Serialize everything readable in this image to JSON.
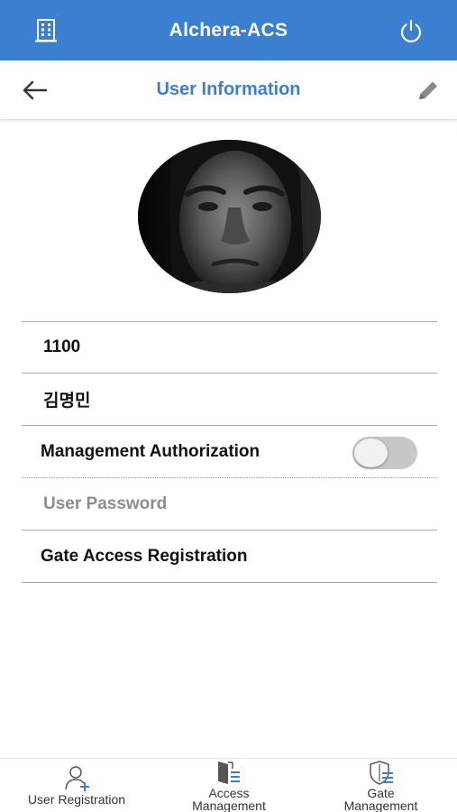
{
  "app_bar": {
    "title": "Alchera-ACS",
    "left_icon": "building-icon",
    "right_icon": "power-icon",
    "background": "#3b7fd0"
  },
  "sub_header": {
    "title": "User Information",
    "back_icon": "back-arrow-icon",
    "edit_icon": "pencil-icon"
  },
  "profile": {
    "avatar": "user-photo"
  },
  "fields": {
    "user_id": "1100",
    "user_name": "김명민",
    "management_authorization": {
      "label": "Management Authorization",
      "enabled": false
    },
    "user_password": {
      "placeholder": "User Password"
    },
    "gate_access_registration": "Gate Access Registration"
  },
  "bottom_nav": {
    "items": [
      {
        "label": "User Registration",
        "icon": "add-user-icon"
      },
      {
        "label_line1": "Access",
        "label_line2": "Management",
        "icon": "door-list-icon"
      },
      {
        "label_line1": "Gate",
        "label_line2": "Management",
        "icon": "shield-list-icon"
      }
    ]
  },
  "colors": {
    "accent": "#3b7fd0",
    "toggle_off": "#c7c7c7",
    "placeholder": "#8d8d8d"
  }
}
